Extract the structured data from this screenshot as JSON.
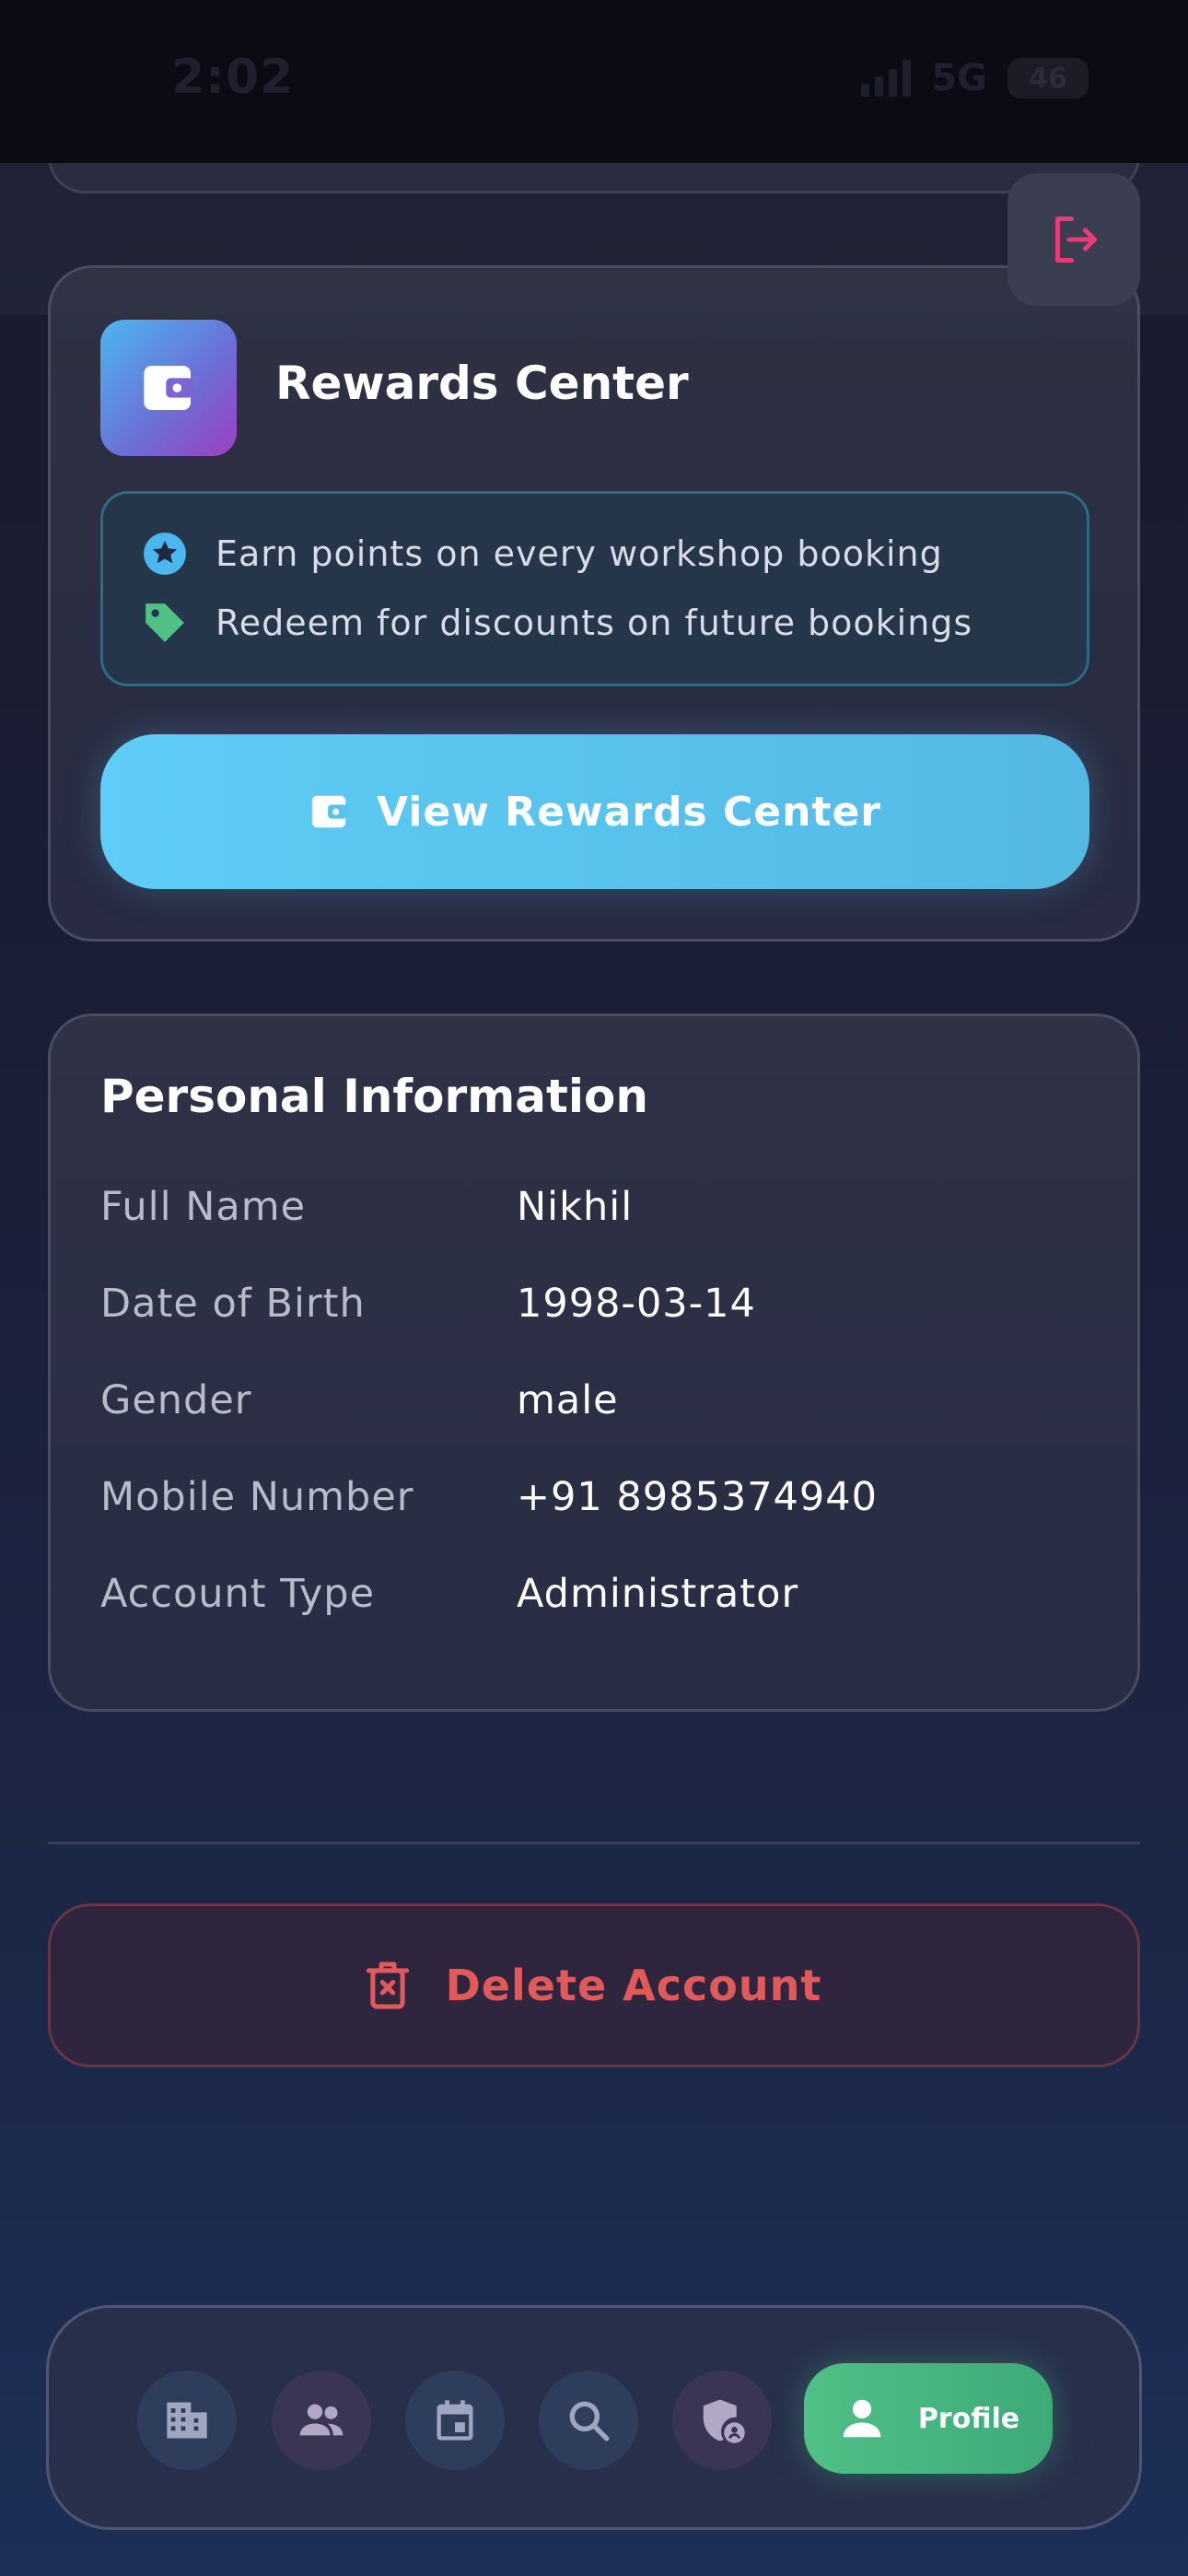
{
  "status_bar": {
    "time": "2:02",
    "network": "5G",
    "battery": "46"
  },
  "rewards": {
    "title": "Rewards Center",
    "features": [
      {
        "icon": "star-circle-icon",
        "text": "Earn points on every workshop booking"
      },
      {
        "icon": "tag-icon",
        "text": "Redeem for discounts on future bookings"
      }
    ],
    "button_label": "View Rewards Center"
  },
  "personal_info": {
    "title": "Personal Information",
    "fields": [
      {
        "label": "Full Name",
        "value": "Nikhil"
      },
      {
        "label": "Date of Birth",
        "value": "1998-03-14"
      },
      {
        "label": "Gender",
        "value": "male"
      },
      {
        "label": "Mobile Number",
        "value": "+91 8985374940"
      },
      {
        "label": "Account Type",
        "value": "Administrator"
      }
    ]
  },
  "delete_account": {
    "label": "Delete Account"
  },
  "bottom_nav": {
    "items": [
      {
        "icon": "building-icon"
      },
      {
        "icon": "people-icon"
      },
      {
        "icon": "calendar-icon"
      },
      {
        "icon": "search-icon"
      },
      {
        "icon": "admin-shield-icon"
      },
      {
        "icon": "person-icon",
        "label": "Profile",
        "active": true
      }
    ]
  },
  "colors": {
    "accent_cyan": "#5ecdf7",
    "danger": "#e05a5a",
    "active_green": "#4fc086",
    "logout_pink": "#e83c78"
  }
}
